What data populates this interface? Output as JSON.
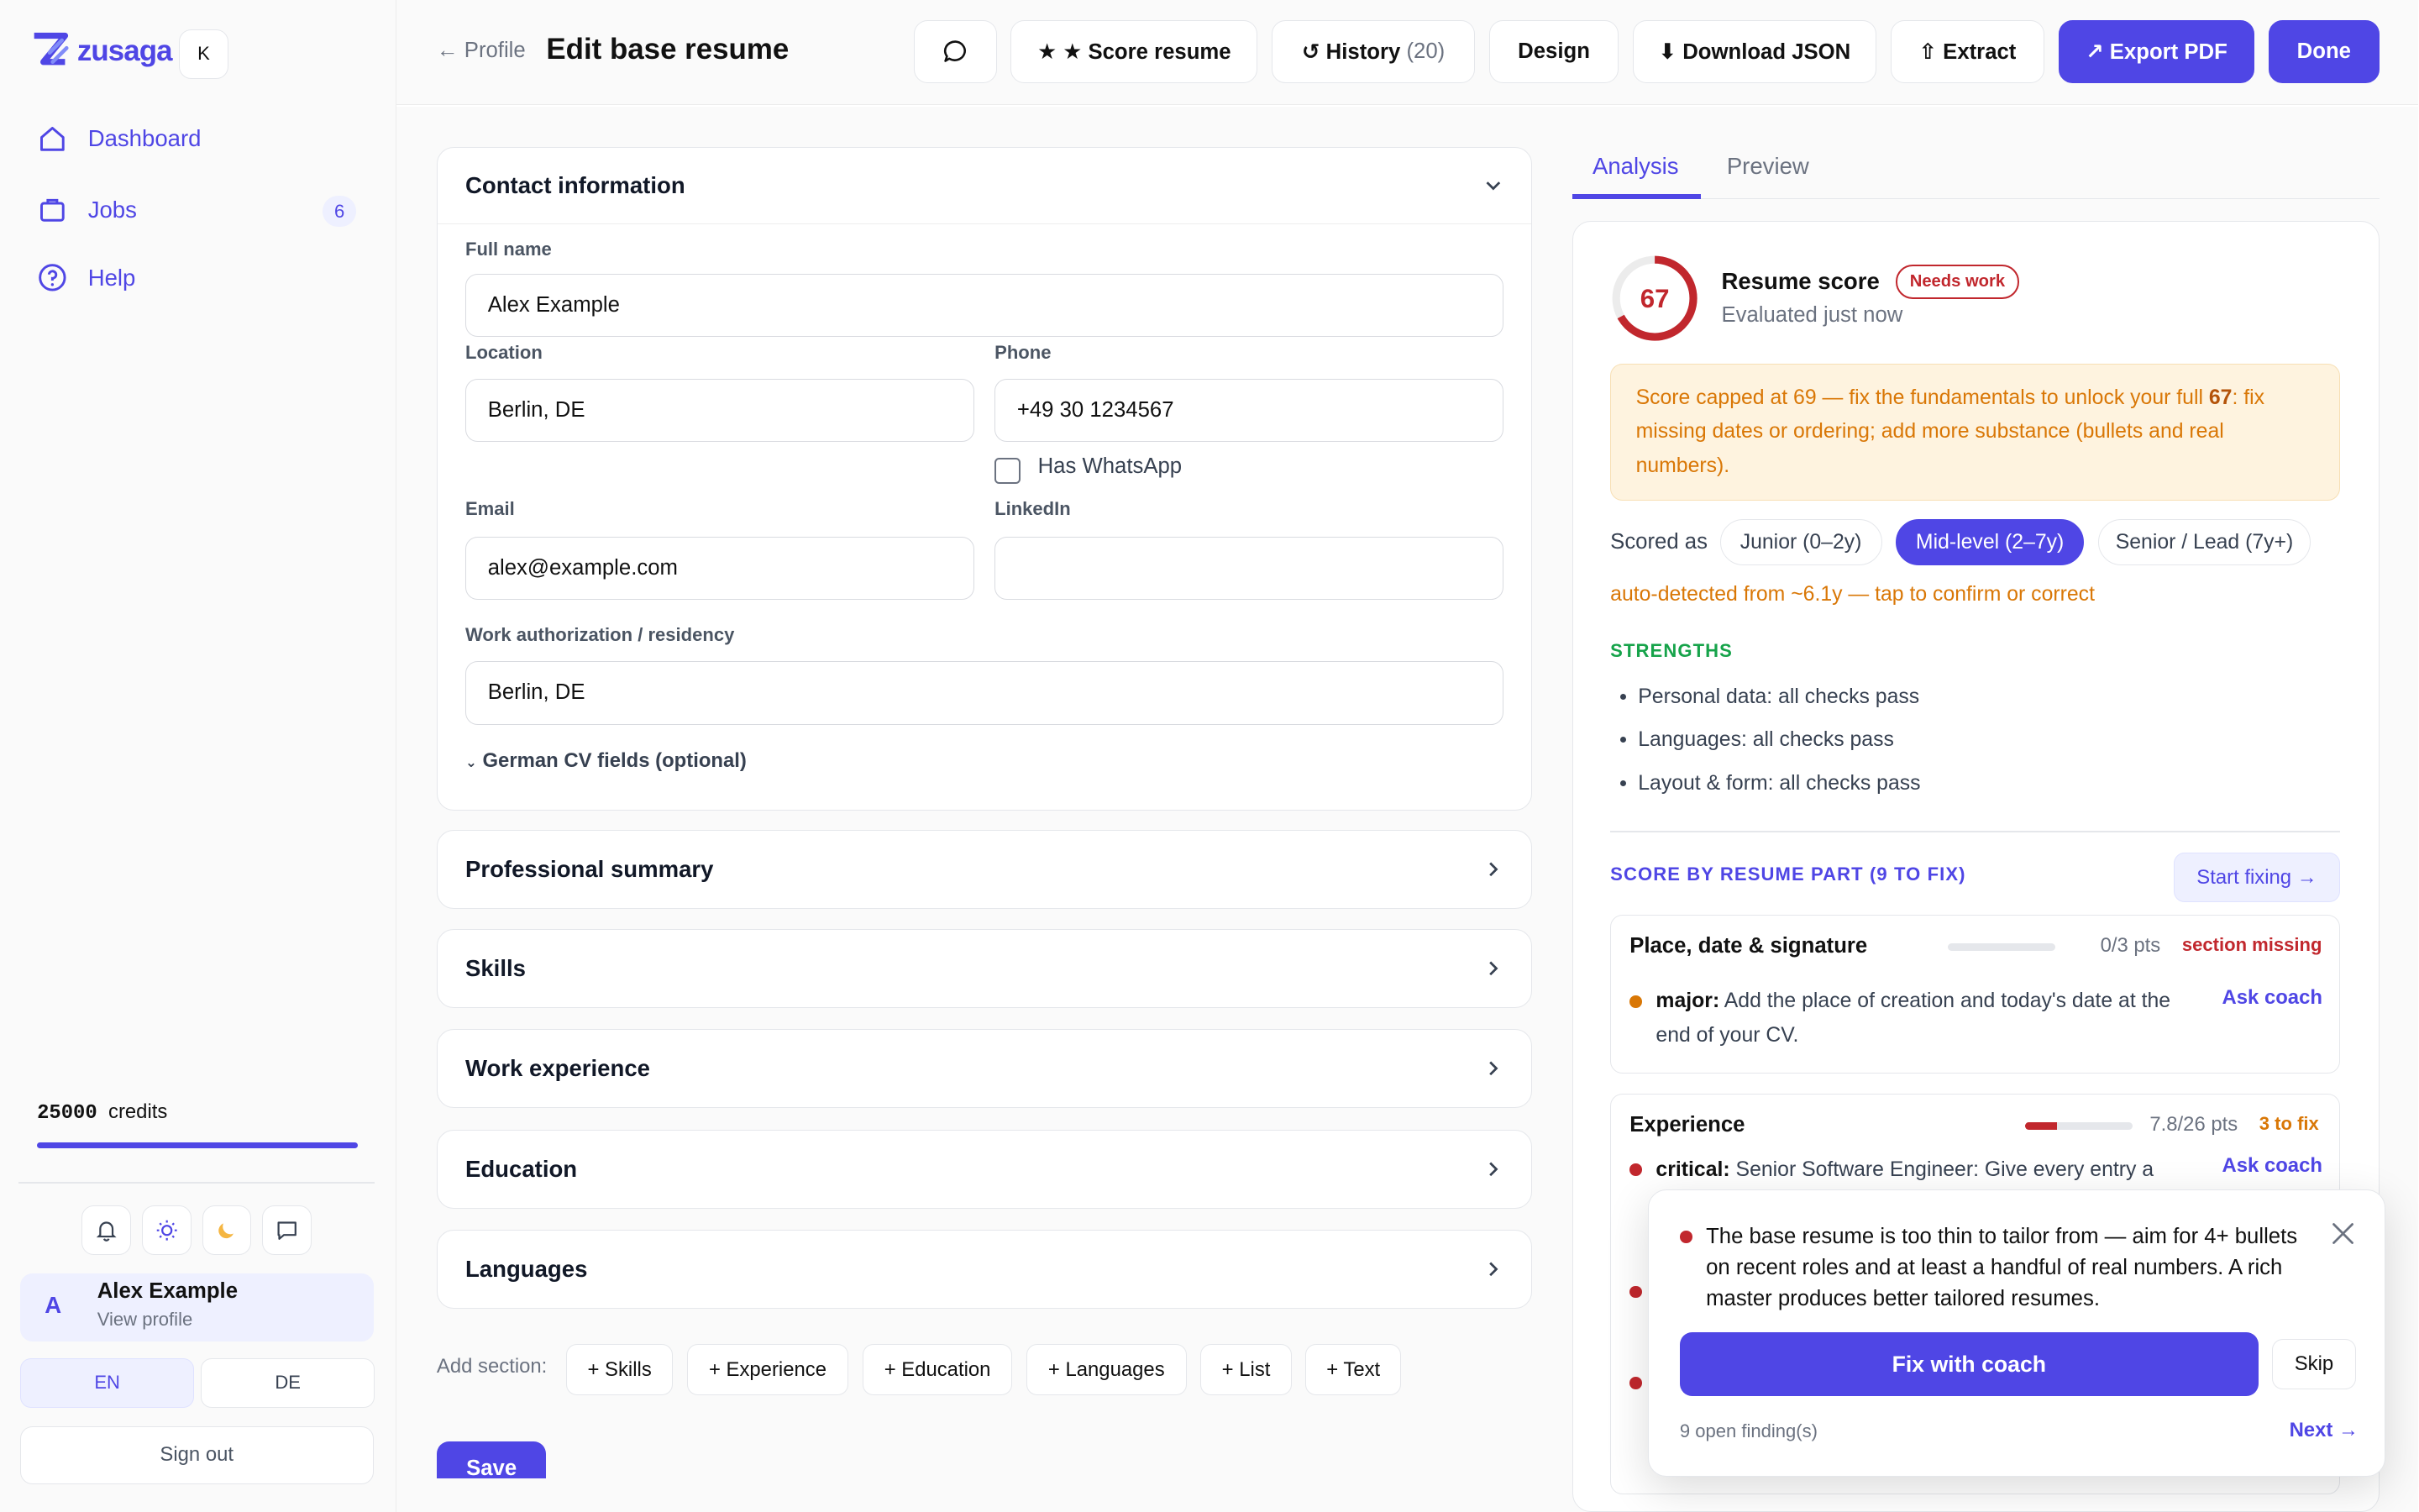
{
  "app": {
    "brand": "zusaga",
    "shortcut_key": "K"
  },
  "sidebar": {
    "items": [
      {
        "label": "Dashboard",
        "icon": "home-icon"
      },
      {
        "label": "Jobs",
        "icon": "briefcase-icon",
        "badge": "6"
      },
      {
        "label": "Help",
        "icon": "help-circle-icon"
      }
    ],
    "credits_value": "25000",
    "credits_label": "credits",
    "credits_fill_fraction": 1.0,
    "icons": [
      "bell-icon",
      "sun-icon",
      "moon-icon",
      "chat-icon"
    ],
    "user": {
      "initial": "A",
      "name": "Alex Example",
      "sub": "View profile"
    },
    "languages": [
      "EN",
      "DE"
    ],
    "active_language": "EN",
    "sign_out": "Sign out"
  },
  "header": {
    "back": "← Profile",
    "title": "Edit base resume",
    "buttons": {
      "score": "★ ★ Score resume",
      "history": "↺ History",
      "history_count": "(20)",
      "design": "Design",
      "download": "⬇ Download JSON",
      "extract": "⇧ Extract",
      "export": "↗ Export PDF",
      "done": "Done"
    }
  },
  "editor": {
    "contact": {
      "title": "Contact information",
      "full_name_label": "Full name",
      "full_name": "Alex Example",
      "location_label": "Location",
      "location": "Berlin, DE",
      "phone_label": "Phone",
      "phone": "+49 30 1234567",
      "whatsapp_label": "Has WhatsApp",
      "email_label": "Email",
      "email": "alex@example.com",
      "linkedin_label": "LinkedIn",
      "linkedin": "",
      "work_auth_label": "Work authorization / residency",
      "work_auth": "Berlin, DE",
      "german_fields": "German CV fields (optional)"
    },
    "sections": [
      "Professional summary",
      "Skills",
      "Work experience",
      "Education",
      "Languages"
    ],
    "add_section_label": "Add section:",
    "add_chips": [
      "+ Skills",
      "+ Experience",
      "+ Education",
      "+ Languages",
      "+ List",
      "+ Text"
    ],
    "save": "Save"
  },
  "analysis": {
    "tabs": [
      "Analysis",
      "Preview"
    ],
    "score": 67,
    "score_max": 100,
    "score_title": "Resume score",
    "status_badge": "Needs work",
    "evaluated": "Evaluated just now",
    "warning_prefix": "Score capped at 69 — fix the fundamentals to unlock your full ",
    "warning_bold": "67",
    "warning_suffix": ": fix missing dates or ordering; add more substance (bullets and real numbers).",
    "scored_as_label": "Scored as",
    "levels": [
      "Junior (0–2y)",
      "Mid-level (2–7y)",
      "Senior / Lead (7y+)"
    ],
    "active_level": "Mid-level (2–7y)",
    "auto_detected": "auto-detected from ~6.1y — tap to confirm or correct",
    "strengths_title": "STRENGTHS",
    "strengths": [
      "Personal data: all checks pass",
      "Languages: all checks pass",
      "Layout & form: all checks pass"
    ],
    "by_part_title": "SCORE BY RESUME PART (9 TO FIX)",
    "start_fixing": "Start fixing →",
    "parts": [
      {
        "name": "Place, date & signature",
        "score": 0,
        "max": 3,
        "pts": "0/3 pts",
        "tag": "section missing",
        "tag_color": "#c1272d",
        "finding_severity": "major:",
        "severity_color": "#d97706",
        "finding": " Add the place of creation and today's date at the end of your CV.",
        "ask": "Ask coach"
      },
      {
        "name": "Experience",
        "score": 7.8,
        "max": 26,
        "pts": "7.8/26 pts",
        "tag": "3 to fix",
        "tag_color": "#d97706",
        "finding_severity": "critical:",
        "severity_color": "#c1272d",
        "finding": " Senior Software Engineer: Give every entry a",
        "ask": "Ask coach"
      }
    ]
  },
  "coach_popup": {
    "text": "The base resume is too thin to tailor from — aim for 4+ bullets on recent roles and at least a handful of real numbers. A rich master produces better tailored resumes.",
    "fix": "Fix with coach",
    "skip": "Skip",
    "open_count": "9 open finding(s)",
    "next": "Next →"
  },
  "colors": {
    "accent": "#4f46e5",
    "danger": "#c1272d",
    "warning": "#d97706",
    "success": "#16a34a"
  }
}
